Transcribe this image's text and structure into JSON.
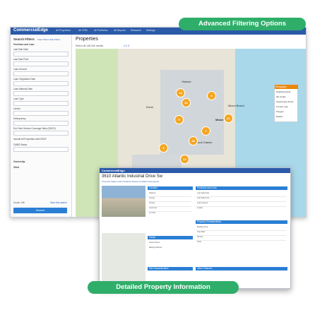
{
  "banners": {
    "top": "Advanced Filtering Options",
    "bottom": "Detailed Property Information"
  },
  "app": {
    "logo": "CommercialEdge",
    "nav": [
      "All Properties",
      "All CRM",
      "All Portfolios",
      "All Reports",
      "Research",
      "Settings"
    ]
  },
  "sidebar": {
    "title": "Search Filters",
    "links": "Clear Filters   Hide Filters",
    "labels": [
      "Purchase and Loan",
      "Last Sale Date",
      "Last Sale Price",
      "Loan Amount",
      "Loan Origination Date",
      "Loan Maturity Date",
      "Loan Type",
      "Lender",
      "Delinquency",
      "Est. Debt Service Coverage Ratio (DSCR)",
      "Include All Properties with DSCR",
      "CMBS Status",
      "Ownership",
      "Other"
    ],
    "status": "Count: 146",
    "save": "Save this search",
    "search_button": "Search"
  },
  "main": {
    "title": "Properties",
    "subtitle": "Select all   148,049 results",
    "pages": "1  2  3"
  },
  "map": {
    "labels": [
      "Hialeah",
      "Miami",
      "Doral",
      "Miami Beach",
      "Coral Gables",
      "Kendall"
    ],
    "markers": [
      "14",
      "22",
      "9",
      "31",
      "18",
      "7",
      "12",
      "5",
      "3"
    ],
    "dropdown_title": "Geography",
    "dropdown_items": [
      "Neighborhoods",
      "Zip Codes",
      "Opportunity Zones",
      "Current map",
      "Polygon",
      "Radius"
    ]
  },
  "detail": {
    "logo": "CommercialEdge",
    "title": "3610 Atlantic Industrial Drive Sw",
    "tabs": "Overview   Sales   Loans   Tenants   Owners   Contacts   Documents",
    "sections": [
      "Location",
      "Purchase and Loan",
      "Property Characteristics",
      "Owner",
      "Site Characteristics",
      "Other Features"
    ],
    "rows": [
      "Address",
      "County",
      "Zoning",
      "Land Use",
      "Lot Size",
      "Building Area",
      "Year Built",
      "Stories",
      "Units",
      "Last Sale Date",
      "Last Sale Price",
      "Loan Amount",
      "Lender",
      "Owner Name",
      "Mailing Address"
    ]
  },
  "colors": {
    "banner": "#2fae6a",
    "header": "#2a5aa8",
    "marker": "#f5a623",
    "accent": "#2a7fd4"
  }
}
